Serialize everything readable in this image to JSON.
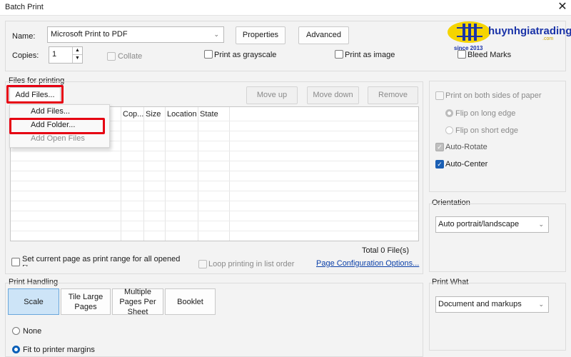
{
  "window": {
    "title": "Batch Print",
    "close_glyph": "✕"
  },
  "printer": {
    "name_label": "Name:",
    "name_value": "Microsoft Print to PDF",
    "properties_label": "Properties",
    "advanced_label": "Advanced",
    "copies_label": "Copies:",
    "copies_value": "1",
    "collate_label": "Collate",
    "grayscale_label": "Print as grayscale",
    "image_label": "Print as image",
    "bleed_label": "Bleed Marks"
  },
  "watermark": {
    "brand": "huynhgiatrading",
    "since": "since 2013",
    "suffix": ".com"
  },
  "files": {
    "section_label": "Files for printing",
    "add_files_label": "Add Files...",
    "move_up_label": "Move up",
    "move_down_label": "Move down",
    "remove_label": "Remove",
    "columns": [
      "Cop...",
      "Size",
      "Location",
      "State"
    ],
    "total": "Total 0 File(s)",
    "set_current_label": "Set current page as print range for all opened files",
    "loop_label": "Loop printing in list order",
    "page_config_link": "Page Configuration Options..."
  },
  "menu": {
    "items": [
      {
        "label": "Add Files...",
        "enabled": true
      },
      {
        "label": "Add Folder...",
        "enabled": true
      },
      {
        "label": "Add Open Files",
        "enabled": false
      }
    ]
  },
  "print_handling": {
    "section_label": "Print Handling",
    "modes": [
      "Scale",
      "Tile Large Pages",
      "Multiple Pages Per Sheet",
      "Booklet"
    ],
    "active_mode": "Scale",
    "options": [
      {
        "label": "None",
        "selected": false
      },
      {
        "label": "Fit to printer margins",
        "selected": true
      }
    ]
  },
  "side_options": {
    "both_sides_label": "Print on both sides of paper",
    "flip_long_label": "Flip on long edge",
    "flip_short_label": "Flip on short edge",
    "auto_rotate_label": "Auto-Rotate",
    "auto_center_label": "Auto-Center",
    "check_glyph": "✓"
  },
  "orientation": {
    "section_label": "Orientation",
    "value": "Auto portrait/landscape"
  },
  "print_what": {
    "section_label": "Print What",
    "value": "Document and markups"
  },
  "colors": {
    "accent": "#1a5fb4",
    "highlight": "#e60012",
    "link": "#0a3fa8",
    "active_mode_bg": "#cde4f7"
  }
}
